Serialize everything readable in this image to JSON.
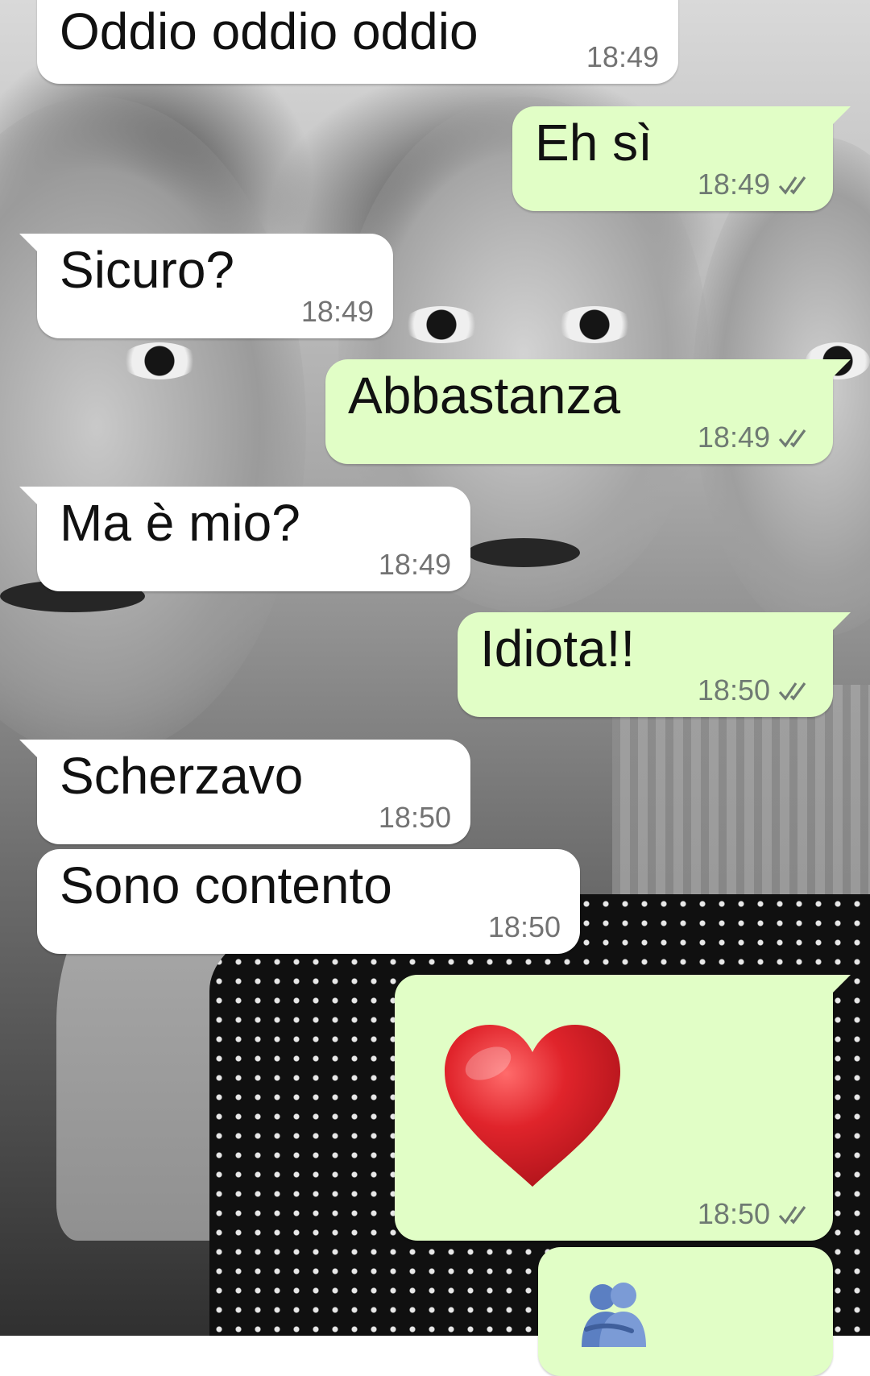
{
  "chat": {
    "messages": [
      {
        "id": "m1",
        "direction": "incoming",
        "text": "Oddio oddio oddio",
        "time": "18:49"
      },
      {
        "id": "m2",
        "direction": "outgoing",
        "text": "Eh sì",
        "time": "18:49",
        "status": "delivered"
      },
      {
        "id": "m3",
        "direction": "incoming",
        "text": "Sicuro?",
        "time": "18:49"
      },
      {
        "id": "m4",
        "direction": "outgoing",
        "text": "Abbastanza",
        "time": "18:49",
        "status": "delivered"
      },
      {
        "id": "m5",
        "direction": "incoming",
        "text": "Ma è mio?",
        "time": "18:49"
      },
      {
        "id": "m6",
        "direction": "outgoing",
        "text": "Idiota!!",
        "time": "18:50",
        "status": "delivered"
      },
      {
        "id": "m7",
        "direction": "incoming",
        "text": "Scherzavo",
        "time": "18:50"
      },
      {
        "id": "m8",
        "direction": "incoming",
        "text": "Sono contento",
        "time": "18:50"
      },
      {
        "id": "m9",
        "direction": "outgoing",
        "emoji": "red-heart",
        "time": "18:50",
        "status": "delivered"
      },
      {
        "id": "m10",
        "direction": "outgoing",
        "emoji": "people-hugging"
      }
    ]
  },
  "colors": {
    "incoming_bubble": "#ffffff",
    "outgoing_bubble": "#e1fec6",
    "timestamp": "#6f7a73",
    "ticks": "#6f7a73",
    "heart": "#e0242b"
  },
  "wallpaper": {
    "style": "black-and-white photo of women's faces",
    "icon": "wallpaper-photo"
  }
}
